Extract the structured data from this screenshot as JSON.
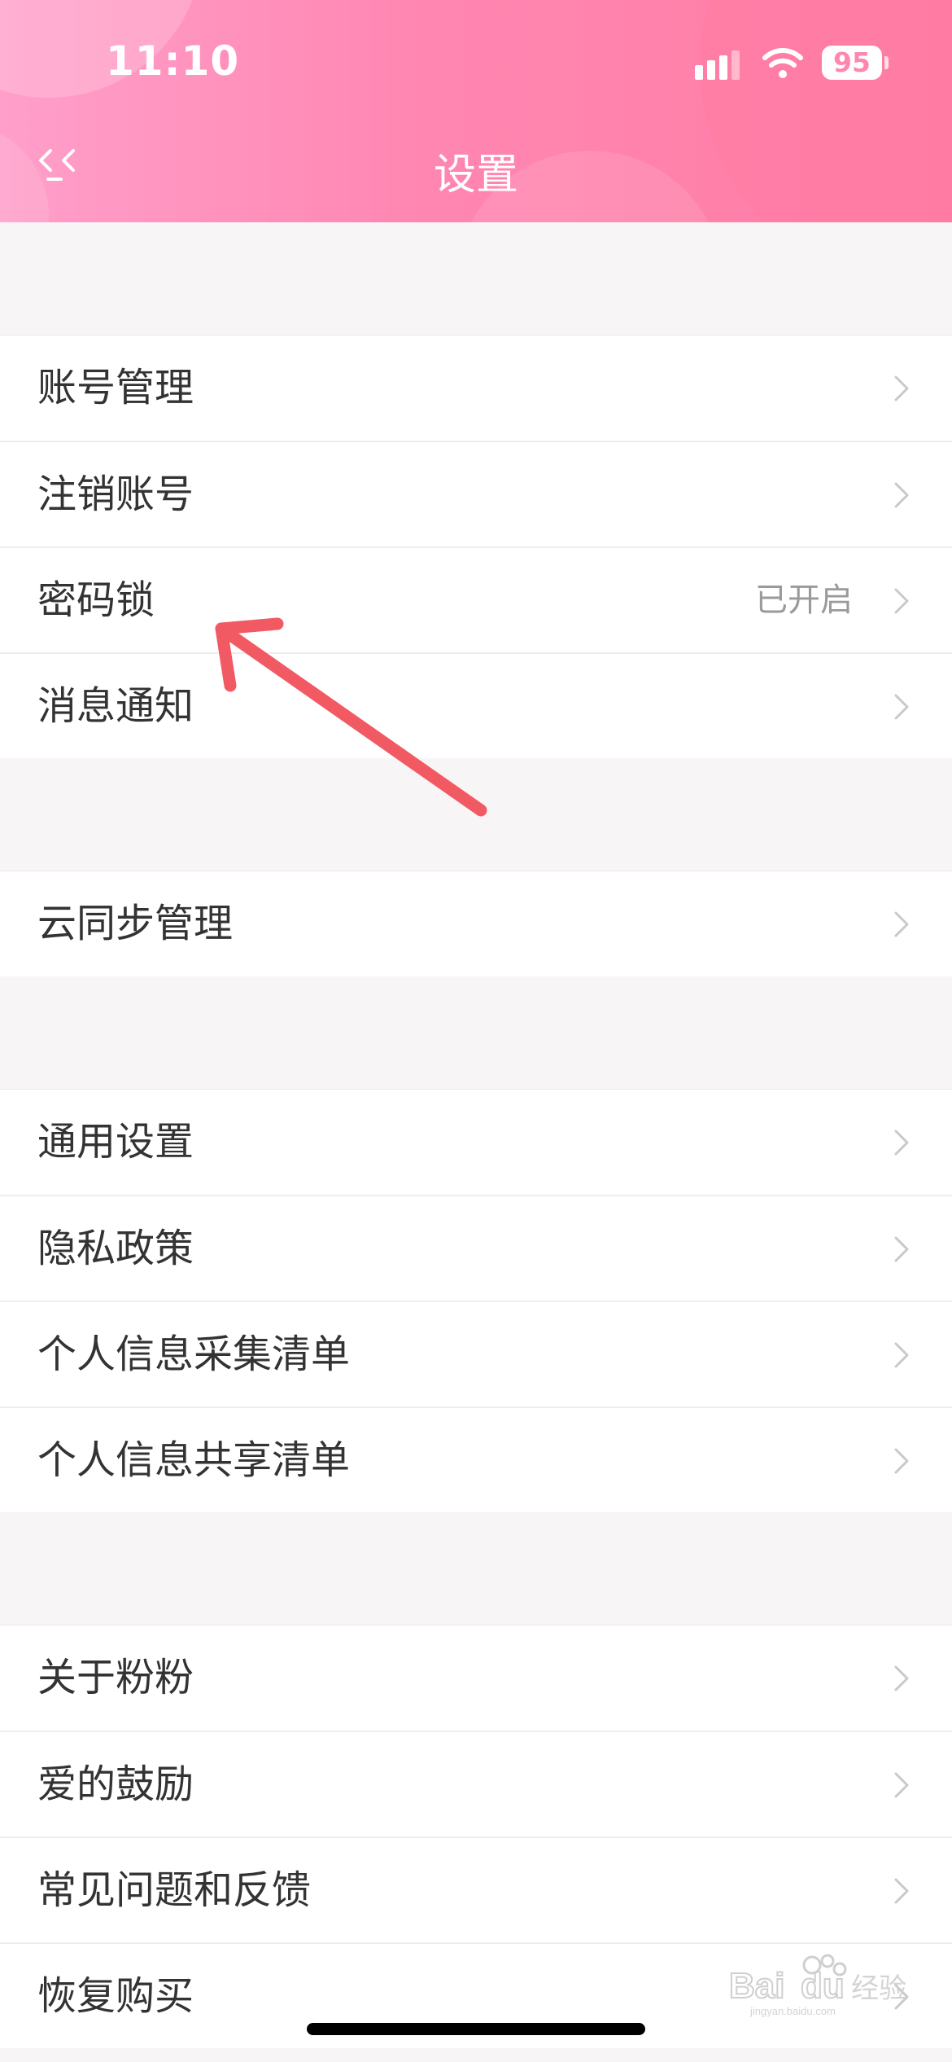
{
  "status_bar": {
    "time": "11:10",
    "battery": "95"
  },
  "nav": {
    "title": "设置"
  },
  "groups": [
    {
      "items": [
        {
          "label": "账号管理"
        },
        {
          "label": "注销账号"
        },
        {
          "label": "密码锁",
          "status": "已开启"
        },
        {
          "label": "消息通知"
        }
      ]
    },
    {
      "items": [
        {
          "label": "云同步管理"
        }
      ]
    },
    {
      "items": [
        {
          "label": "通用设置"
        },
        {
          "label": "隐私政策"
        },
        {
          "label": "个人信息采集清单"
        },
        {
          "label": "个人信息共享清单"
        }
      ]
    },
    {
      "items": [
        {
          "label": "关于粉粉"
        },
        {
          "label": "爱的鼓励"
        },
        {
          "label": "常见问题和反馈"
        },
        {
          "label": "恢复购买"
        }
      ]
    }
  ],
  "watermark": {
    "logo_text": "Baidu经验",
    "url": "jingyan.baidu.com"
  },
  "colors": {
    "header_start": "#ff9fca",
    "header_end": "#ff7da5",
    "annotation_arrow": "#f25a63"
  },
  "icons": {
    "back": "double-chevron-left-icon",
    "row": "chevron-right-icon"
  }
}
